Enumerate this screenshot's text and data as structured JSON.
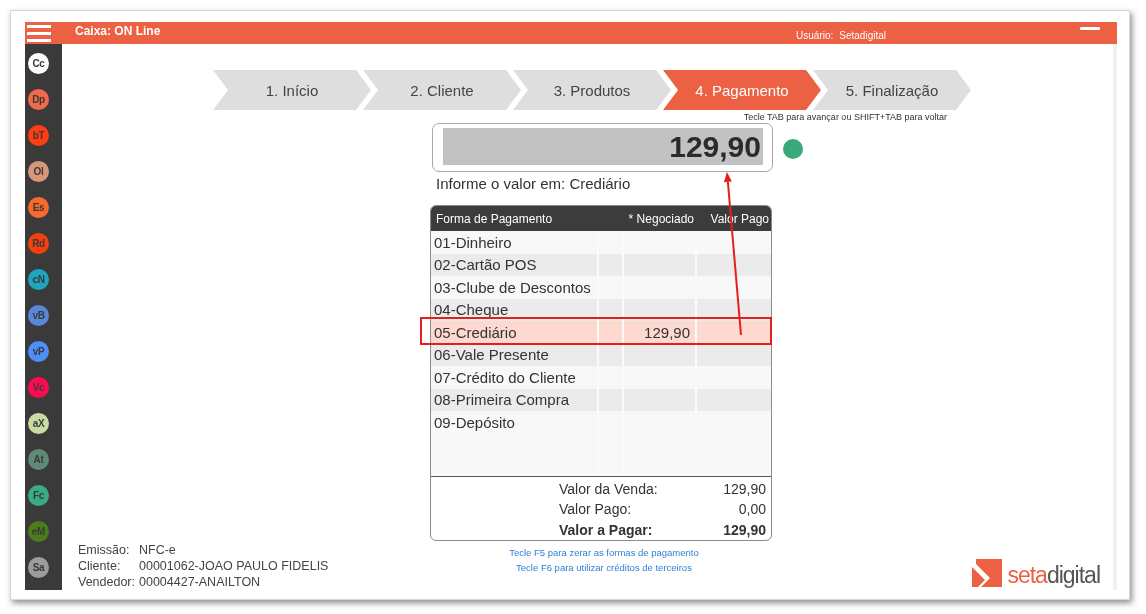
{
  "window": {
    "title": "Caixa: ON Line",
    "user_label": "Usuário:",
    "user": "Setadigital"
  },
  "sidebar": {
    "items": [
      {
        "label": "Cc",
        "color": "#ffffff"
      },
      {
        "label": "Dp",
        "color": "#f26a4b"
      },
      {
        "label": "bT",
        "color": "#ff3c12"
      },
      {
        "label": "Ol",
        "color": "#d9977a"
      },
      {
        "label": "Es",
        "color": "#f8692e"
      },
      {
        "label": "Rd",
        "color": "#f4400f"
      },
      {
        "label": "cN",
        "color": "#1ea5c0"
      },
      {
        "label": "vB",
        "color": "#5b87d9"
      },
      {
        "label": "vP",
        "color": "#4e8ef7"
      },
      {
        "label": "Vc",
        "color": "#fc0b4f"
      },
      {
        "label": "aX",
        "color": "#c9dba2"
      },
      {
        "label": "At",
        "color": "#5e8a76"
      },
      {
        "label": "Fc",
        "color": "#3bab85"
      },
      {
        "label": "eM",
        "color": "#4d7c1b"
      },
      {
        "label": "Sa",
        "color": "#9c9c9c"
      }
    ]
  },
  "steps": [
    {
      "label": "1. Início",
      "selected": false
    },
    {
      "label": "2. Cliente",
      "selected": false
    },
    {
      "label": "3. Produtos",
      "selected": false
    },
    {
      "label": "4. Pagamento",
      "selected": true
    },
    {
      "label": "5. Finalização",
      "selected": false
    }
  ],
  "steps_hint": "Tecle TAB para avançar ou SHIFT+TAB para voltar",
  "amount": {
    "value": "129,90"
  },
  "prompt": "Informe o valor em: Crediário",
  "table": {
    "columns": [
      "Forma de Pagamento",
      "* Negociado",
      "Valor Pago"
    ],
    "rows": [
      {
        "name": "01-Dinheiro",
        "selected": false
      },
      {
        "name": "02-Cartão POS",
        "selected": false
      },
      {
        "name": "03-Clube de Descontos",
        "selected": false
      },
      {
        "name": "04-Cheque",
        "selected": false
      },
      {
        "name": "05-Crediário",
        "negotiated": "129,90",
        "selected": true
      },
      {
        "name": "06-Vale Presente",
        "selected": false
      },
      {
        "name": "07-Crédito do Cliente",
        "selected": false
      },
      {
        "name": "08-Primeira Compra",
        "selected": false
      },
      {
        "name": "09-Depósito",
        "selected": false
      }
    ],
    "summary": [
      {
        "label": "Valor da Venda:",
        "value": "129,90",
        "kind": "subtotal"
      },
      {
        "label": "Valor Pago:",
        "value": "0,00",
        "kind": "subtotal"
      },
      {
        "label": "Valor a Pagar:",
        "value": "129,90",
        "kind": "total"
      }
    ]
  },
  "shortcuts": [
    "Tecle F5 para zerar as formas de pagamento",
    "Tecle F6 para utilizar créditos de terceiros"
  ],
  "document": [
    {
      "label": "Emissão:",
      "value": "NFC-e"
    },
    {
      "label": "Cliente:",
      "value": "00001062-JOAO PAULO FIDELIS"
    },
    {
      "label": "Vendedor:",
      "value": "00004427-ANAILTON"
    }
  ],
  "logo": {
    "part_1": "seta",
    "part_2": "digital"
  }
}
